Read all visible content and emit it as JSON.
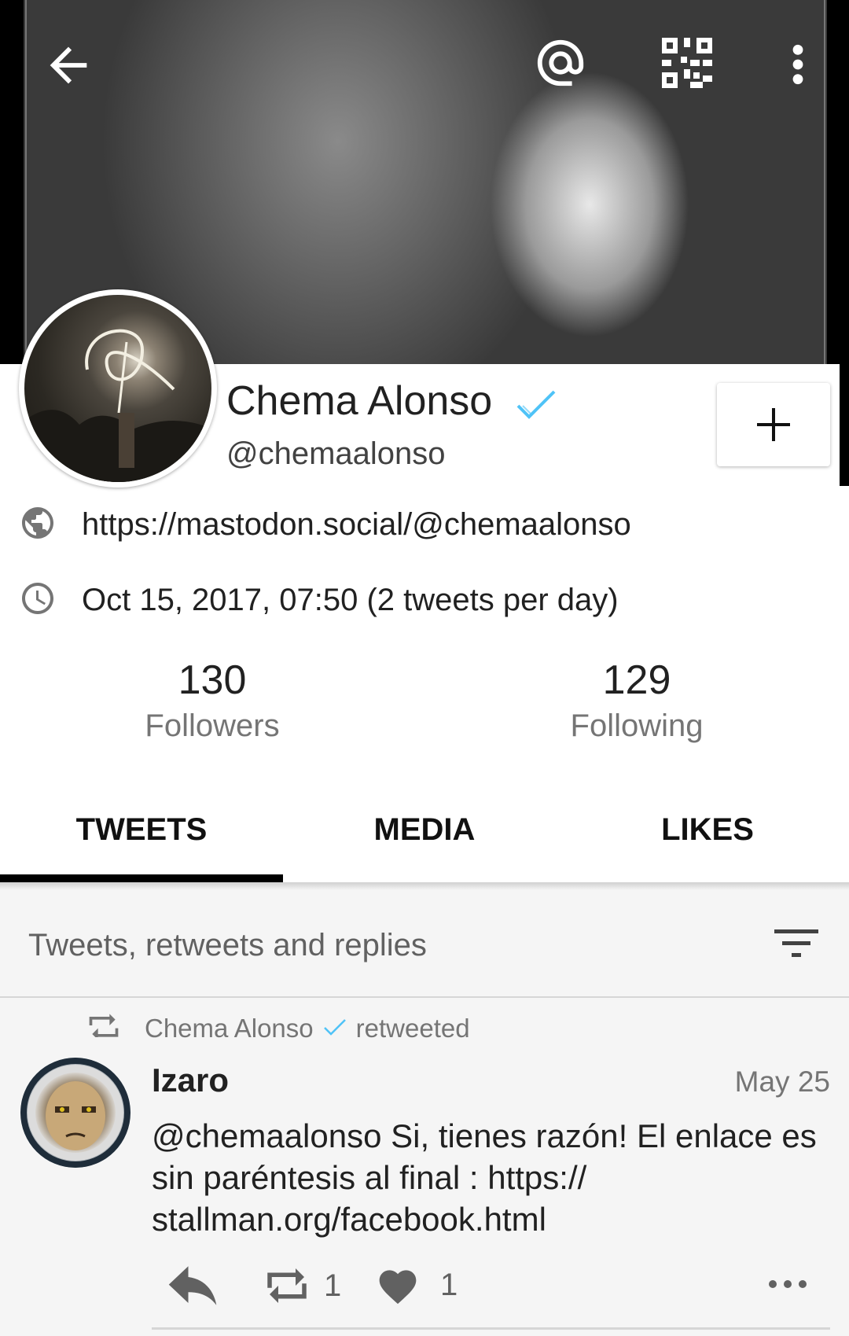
{
  "toolbar": {
    "back_icon": "arrow-left-icon",
    "mention_icon": "at-sign-icon",
    "qr_icon": "qr-code-icon",
    "more_icon": "more-vertical-icon"
  },
  "profile": {
    "name": "Chema Alonso",
    "verified": true,
    "handle": "@chemaalonso",
    "follow_label": "+",
    "url": "https://mastodon.social/@chemaalonso",
    "joined": "Oct 15, 2017, 07:50 (2 tweets per day)",
    "followers_count": "130",
    "followers_label": "Followers",
    "following_count": "129",
    "following_label": "Following"
  },
  "tabs": [
    {
      "label": "TWEETS",
      "selected": true
    },
    {
      "label": "MEDIA",
      "selected": false
    },
    {
      "label": "LIKES",
      "selected": false
    }
  ],
  "filter": {
    "label": "Tweets, retweets and replies"
  },
  "tweet": {
    "retweeted_by": "Chema Alonso",
    "retweeted_suffix": "retweeted",
    "author": "Izaro",
    "date": "May 25",
    "body": "@chemaalonso Si, tienes razón! El enlace es sin paréntesis al final : https:// stallman.org/facebook.html",
    "retweet_count": "1",
    "like_count": "1"
  },
  "colors": {
    "verified": "#4fc3f7",
    "tab_indicator": "#000000",
    "background": "#f5f5f5"
  }
}
